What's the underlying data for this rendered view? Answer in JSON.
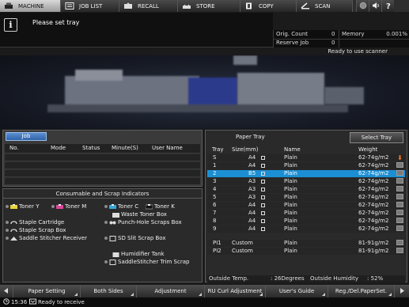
{
  "top_tabs": [
    {
      "label": "MACHINE",
      "icon": "printer-icon",
      "active": true
    },
    {
      "label": "JOB LIST",
      "icon": "job-list-icon",
      "active": false
    },
    {
      "label": "RECALL",
      "icon": "recall-icon",
      "active": false
    },
    {
      "label": "STORE",
      "icon": "store-icon",
      "active": false
    },
    {
      "label": "COPY",
      "icon": "copy-icon",
      "active": false
    },
    {
      "label": "SCAN",
      "icon": "scan-icon",
      "active": false
    }
  ],
  "top_buttons": [
    "settings-circle-icon",
    "volume-icon",
    "help-icon"
  ],
  "message": "Please set tray",
  "counters": {
    "orig_count_label": "Orig. Count",
    "orig_count_value": "0",
    "memory_label": "Memory",
    "memory_value": "0.001%",
    "reserve_job_label": "Reserve Job",
    "reserve_job_value": "0"
  },
  "scanner_status": "Ready to use scanner",
  "job_panel": {
    "tab_label": "Job",
    "columns": [
      "No.",
      "Mode",
      "Status",
      "Minute(S)",
      "User Name"
    ]
  },
  "consumables": {
    "title": "Consumable and Scrap Indicators",
    "toner_y": "Toner Y",
    "toner_m": "Toner M",
    "toner_c": "Toner C",
    "toner_k": "Toner K",
    "waste_toner": "Waste Toner Box",
    "punch_scraps": "Punch-Hole Scraps Box",
    "staple_cartridge": "Staple Cartridge",
    "staple_scrap": "Staple Scrap Box",
    "saddle_receiver": "Saddle Stitcher Receiver",
    "sd_slit": "SD Slit Scrap Box",
    "humidifier": "Humidifier Tank",
    "saddle_trim": "SaddleStitcher Trim Scrap"
  },
  "paper_tray": {
    "title": "Paper Tray",
    "select_button": "Select Tray",
    "columns": [
      "Tray",
      "Size(mm)",
      "Name",
      "Weight"
    ],
    "rows": [
      {
        "tray": "S",
        "size": "A4",
        "name": "Plain",
        "weight": "62-74g/m2",
        "selected": false,
        "warn": true
      },
      {
        "tray": "1",
        "size": "A4",
        "name": "Plain",
        "weight": "62-74g/m2",
        "selected": false,
        "warn": false
      },
      {
        "tray": "2",
        "size": "B5",
        "name": "Plain",
        "weight": "62-74g/m2",
        "selected": true,
        "warn": false
      },
      {
        "tray": "3",
        "size": "A3",
        "name": "Plain",
        "weight": "62-74g/m2",
        "selected": false,
        "warn": false
      },
      {
        "tray": "4",
        "size": "A3",
        "name": "Plain",
        "weight": "62-74g/m2",
        "selected": false,
        "warn": false
      },
      {
        "tray": "5",
        "size": "A3",
        "name": "Plain",
        "weight": "62-74g/m2",
        "selected": false,
        "warn": false
      },
      {
        "tray": "6",
        "size": "A4",
        "name": "Plain",
        "weight": "62-74g/m2",
        "selected": false,
        "warn": false
      },
      {
        "tray": "7",
        "size": "A4",
        "name": "Plain",
        "weight": "62-74g/m2",
        "selected": false,
        "warn": false
      },
      {
        "tray": "8",
        "size": "A4",
        "name": "Plain",
        "weight": "62-74g/m2",
        "selected": false,
        "warn": false
      },
      {
        "tray": "9",
        "size": "A4",
        "name": "Plain",
        "weight": "62-74g/m2",
        "selected": false,
        "warn": false
      },
      {
        "tray": "PI1",
        "size": "Custom",
        "name": "Plain",
        "weight": "81-91g/m2",
        "selected": false,
        "warn": false
      },
      {
        "tray": "PI2",
        "size": "Custom",
        "name": "Plain",
        "weight": "81-91g/m2",
        "selected": false,
        "warn": false
      }
    ],
    "outside_temp_label": "Outside Temp.",
    "outside_temp_value": ": 26Degrees",
    "outside_humidity_label": "Outside Humidity",
    "outside_humidity_value": ": 52%"
  },
  "bottom_buttons": [
    "Paper Setting",
    "Both Sides",
    "Adjustment",
    "RU Curl Adjustment",
    "User's Guide",
    "Reg./Del.PaperSet."
  ],
  "status_line": {
    "time": "15:36",
    "text": "Ready to receive"
  }
}
